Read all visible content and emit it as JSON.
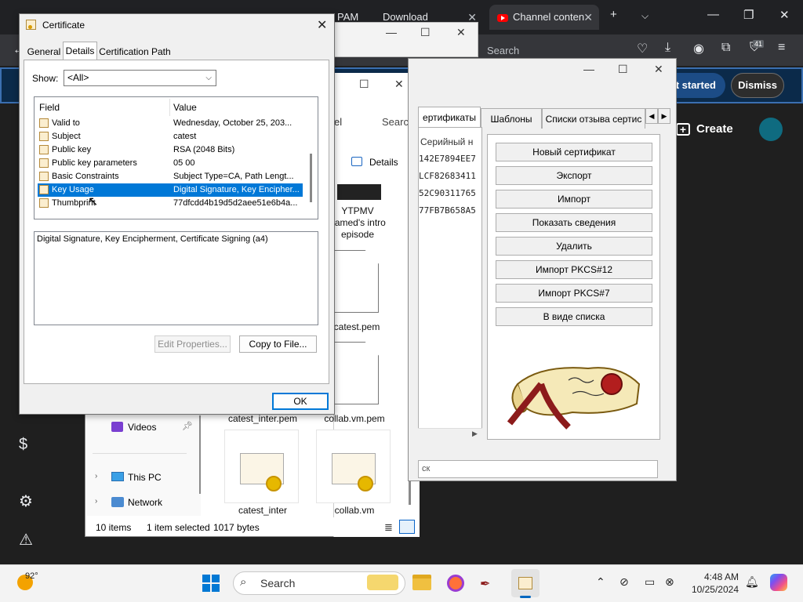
{
  "browser": {
    "tabs": [
      {
        "label": "PAM"
      },
      {
        "label": "Download"
      },
      {
        "label": "Channel conten"
      }
    ],
    "search_placeholder": "Search",
    "extension_badge": "41",
    "banner": {
      "get_started": "et started",
      "dismiss": "Dismiss"
    },
    "create_label": "Create"
  },
  "certificate_dialog": {
    "title": "Certificate",
    "tabs": [
      "General",
      "Details",
      "Certification Path"
    ],
    "show_label": "Show:",
    "show_value": "<All>",
    "columns": {
      "field": "Field",
      "value": "Value"
    },
    "rows": [
      {
        "field": "Valid to",
        "value": "Wednesday, October 25, 203..."
      },
      {
        "field": "Subject",
        "value": "catest"
      },
      {
        "field": "Public key",
        "value": "RSA (2048 Bits)"
      },
      {
        "field": "Public key parameters",
        "value": "05 00"
      },
      {
        "field": "Basic Constraints",
        "value": "Subject Type=CA, Path Lengt..."
      },
      {
        "field": "Key Usage",
        "value": "Digital Signature, Key Encipher..."
      },
      {
        "field": "Thumbprint",
        "value": "77dfcdd4b19d5d2aee51e6b4a..."
      }
    ],
    "detail_text": "Digital Signature, Key Encipherment, Certificate Signing (a4)",
    "edit_properties": "Edit Properties...",
    "copy_to_file": "Copy to File...",
    "ok": "OK"
  },
  "explorer": {
    "search_label": "Search",
    "details_label": "Details",
    "name_fragment": "el",
    "files": [
      {
        "name": "YTPMV\nnamed's intro\nepisode"
      },
      {
        "name": "catest.pem"
      },
      {
        "name": "catest_inter.pem"
      },
      {
        "name": "collab.vm.pem"
      },
      {
        "name": "catest_inter"
      },
      {
        "name": "collab.vm"
      }
    ],
    "nav": [
      {
        "label": "Videos"
      },
      {
        "label": "This PC"
      },
      {
        "label": "Network"
      }
    ],
    "status": {
      "items": "10 items",
      "selected": "1 item selected",
      "size": "1017 bytes"
    }
  },
  "certmgr": {
    "tabs": [
      "ертификаты",
      "Шаблоны",
      "Списки отзыва сертис"
    ],
    "serial_header": "Серийный н",
    "serials": [
      "142E7894EE7",
      "LCF82683411",
      "52C90311765",
      "77FB7B658A5"
    ],
    "buttons": [
      "Новый сертификат",
      "Экспорт",
      "Импорт",
      "Показать сведения",
      "Удалить",
      "Импорт PKCS#12",
      "Импорт PKCS#7",
      "В виде списка"
    ],
    "scroll_text": "ск"
  },
  "taskbar": {
    "weather": "92°",
    "search": "Search",
    "time": "4:48 AM",
    "date": "10/25/2024"
  }
}
